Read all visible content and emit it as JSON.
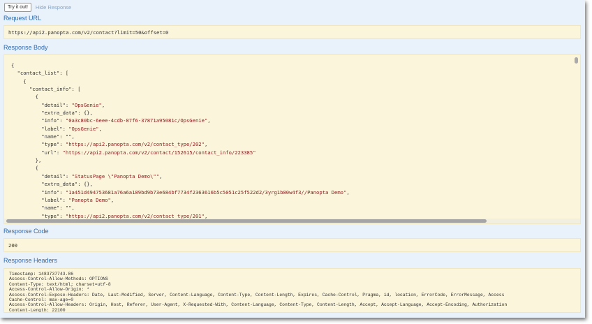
{
  "toolbar": {
    "try_label": "Try it out!",
    "hide_label": "Hide Response"
  },
  "request_url": {
    "heading": "Request URL",
    "value": "https://api2.panopta.com/v2/contact?limit=50&offset=0"
  },
  "response_body": {
    "heading": "Response Body",
    "lines": [
      "{",
      "  \"contact_list\": [",
      "    {",
      "      \"contact_info\": [",
      "        {",
      "          \"detail\": \"OpsGenie\",",
      "          \"extra_data\": {},",
      "          \"info\": \"0a3c80bc-6eee-4cdb-87f6-37871a95081c/OpsGenie\",",
      "          \"label\": \"OpsGenie\",",
      "          \"name\": \"\",",
      "          \"type\": \"https://api2.panopta.com/v2/contact_type/202\",",
      "          \"url\": \"https://api2.panopta.com/v2/contact/152615/contact_info/223385\"",
      "        },",
      "        {",
      "          \"detail\": \"StatusPage \\\"Panopta Demo\\\"\",",
      "          \"extra_data\": {},",
      "          \"info\": \"1a451d494753681a76a6a189bd9b73e684bf7734f2363616b5c5051c25f522d2/3yrg1b80w4f3//Panopta Demo\",",
      "          \"label\": \"Panopta Demo\",",
      "          \"name\": \"\",",
      "          \"type\": \"https://api2.panopta.com/v2/contact_type/201\","
    ]
  },
  "response_code": {
    "heading": "Response Code",
    "value": "200"
  },
  "response_headers": {
    "heading": "Response Headers",
    "lines": [
      "Timestamp: 1483737743.86",
      "Access-Control-Allow-Methods: OPTIONS",
      "Content-Type: text/html; charset=utf-8",
      "Access-Control-Allow-Origin: *",
      "Access-Control-Expose-Headers: Date, Last-Modified, Server, Content-Language, Content-Type, Content-Length, Expires, Cache-Control, Pragma, id, location, ErrorCode, ErrorMessage, Access",
      "Cache-Control: max-age=0",
      "Access-Control-Allow-Headers: Origin, Host, Referer, User-Agent, X-Requested-With, Content-Language, Content-Type, Content-Length, Accept, Accept-Language, Accept-Encoding, Authorization",
      "Content-Length: 22100"
    ]
  }
}
